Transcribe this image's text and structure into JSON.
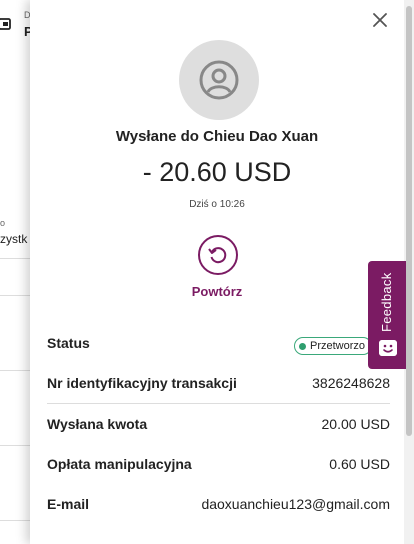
{
  "background": {
    "header_small": "D",
    "header_big": "P",
    "filter_small": "o",
    "filter_text": "zystk"
  },
  "drawer": {
    "title": "Wysłane do Chieu Dao Xuan",
    "amount": "- 20.60 USD",
    "date": "Dziś o 10:26",
    "repeat_label": "Powtórz",
    "rows": [
      {
        "label": "Status",
        "value": "Przetworzo"
      },
      {
        "label": "Nr identyfikacyjny transakcji",
        "value": "3826248628"
      },
      {
        "label": "Wysłana kwota",
        "value": "20.00 USD"
      },
      {
        "label": "Opłata manipulacyjna",
        "value": "0.60 USD"
      },
      {
        "label": "E-mail",
        "value": "daoxuanchieu123@gmail.com"
      }
    ],
    "feedback_label": "Feedback"
  },
  "colors": {
    "brand": "#7b1b63",
    "status_green": "#2e9e6e",
    "avatar_bg": "#dedede"
  },
  "icons": {
    "close": "close-icon",
    "avatar": "user-avatar-icon",
    "repeat": "repeat-icon",
    "wallet": "wallet-icon",
    "feedback": "feedback-face-icon"
  }
}
